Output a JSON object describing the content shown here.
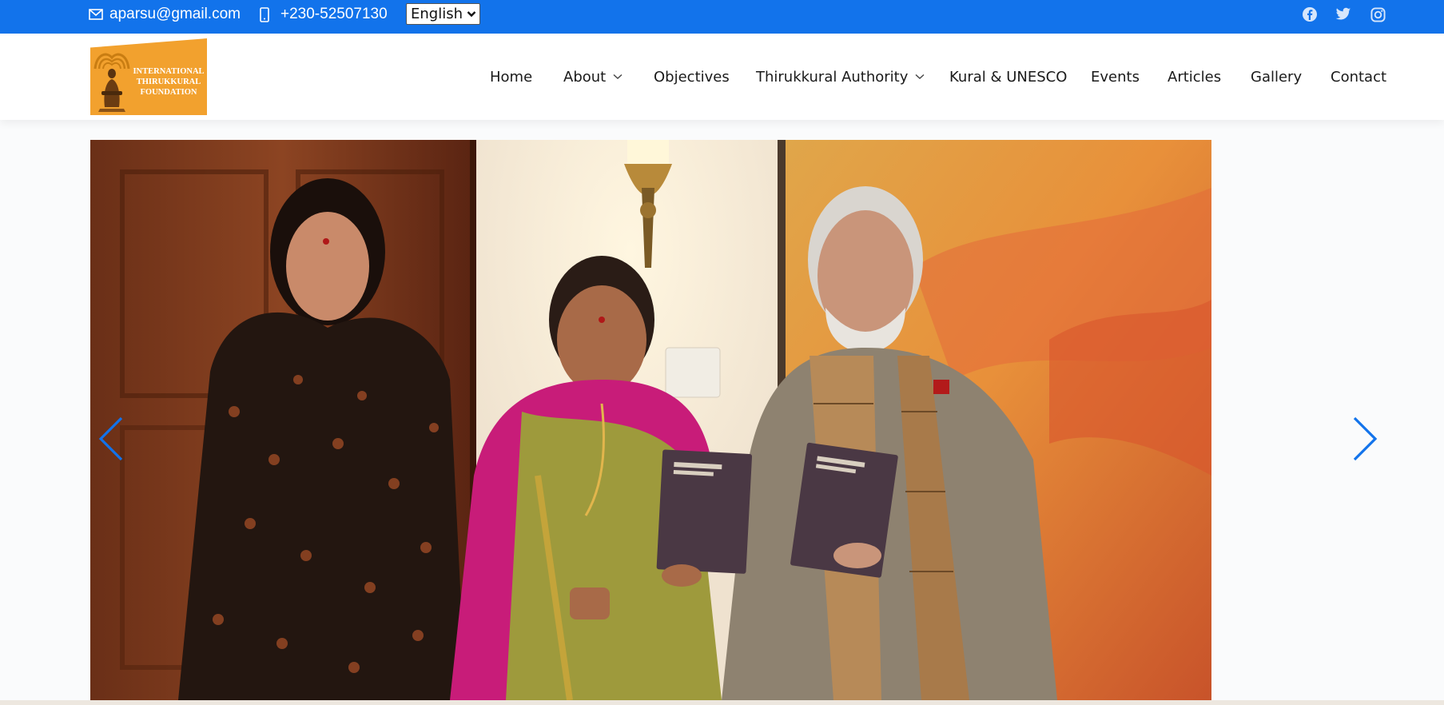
{
  "topbar": {
    "email": "aparsu@gmail.com",
    "phone": "+230-52507130",
    "language": "English",
    "social_icons": [
      "facebook-icon",
      "twitter-icon",
      "instagram-icon"
    ],
    "background": "#1273eb"
  },
  "header": {
    "logo_text": [
      "INTERNATIONAL",
      "THIRUKKURAL",
      "FOUNDATION"
    ],
    "logo_color": "#f2a12e",
    "nav": [
      {
        "label": "Home",
        "dropdown": false
      },
      {
        "label": "About",
        "dropdown": true
      },
      {
        "label": "Objectives",
        "dropdown": false
      },
      {
        "label": "Thirukkural Authority",
        "dropdown": true
      },
      {
        "label": "Kural & UNESCO",
        "dropdown": false
      },
      {
        "label": "Events",
        "dropdown": false
      },
      {
        "label": "Articles",
        "dropdown": false
      },
      {
        "label": "Gallery",
        "dropdown": false
      },
      {
        "label": "Contact",
        "dropdown": false
      }
    ]
  },
  "slider": {
    "prev_icon": "chevron-left-icon",
    "next_icon": "chevron-right-icon",
    "arrow_color": "#1273eb"
  }
}
